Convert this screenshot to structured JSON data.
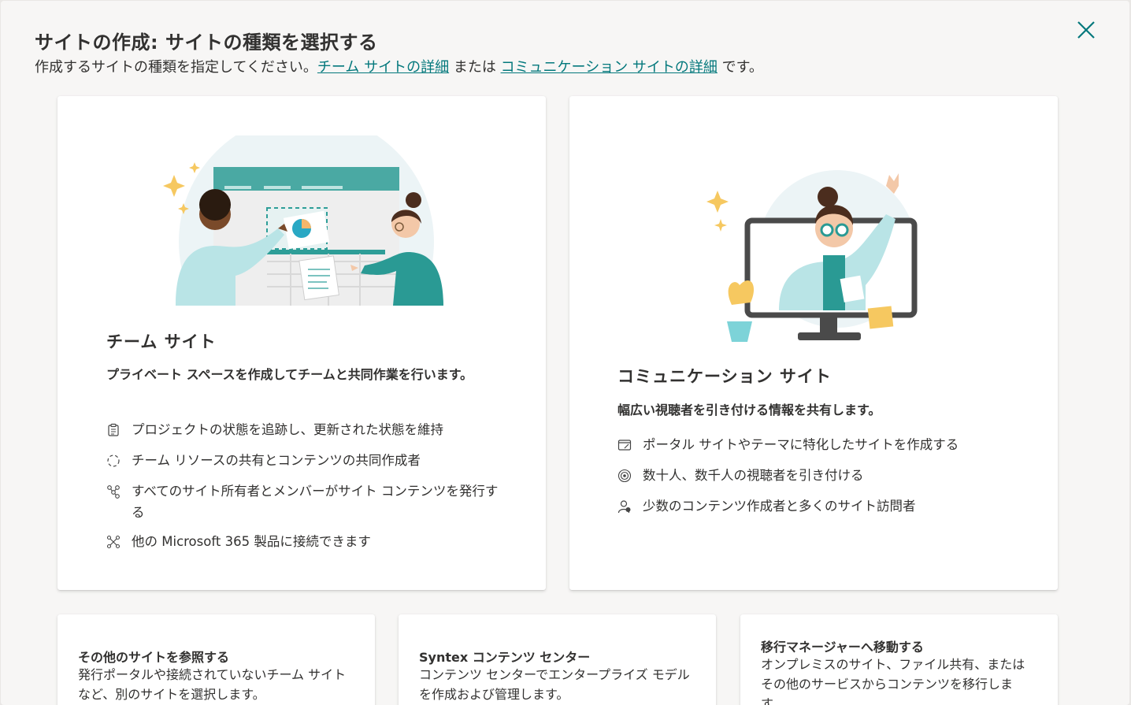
{
  "dialog": {
    "title": "サイトの作成: サイトの種類を選択する",
    "subtitle_prefix": "作成するサイトの種類を指定してください。",
    "link_team": "チーム サイトの詳細",
    "subtitle_mid": " または ",
    "link_comm": "コミュニケーション サイトの詳細",
    "subtitle_suffix": " です。",
    "accent_color": "#03787c"
  },
  "team_site": {
    "heading": "チーム サイト",
    "description": "プライベート スペースを作成してチームと共同作業を行います。",
    "features": [
      {
        "icon": "clipboard-icon",
        "text": "プロジェクトの状態を追跡し、更新された状態を維持"
      },
      {
        "icon": "sync-icon",
        "text": "チーム リソースの共有とコンテンツの共同作成者"
      },
      {
        "icon": "people-network-icon",
        "text": "すべてのサイト所有者とメンバーがサイト コンテンツを発行する"
      },
      {
        "icon": "connect-icon",
        "text": "他の Microsoft 365 製品に接続できます"
      }
    ]
  },
  "communication_site": {
    "heading": "コミュニケーション サイト",
    "description": "幅広い視聴者を引き付ける情報を共有します。",
    "features": [
      {
        "icon": "publish-icon",
        "text": "ポータル サイトやテーマに特化したサイトを作成する"
      },
      {
        "icon": "broadcast-icon",
        "text": "数十人、数千人の視聴者を引き付ける"
      },
      {
        "icon": "person-icon",
        "text": "少数のコンテンツ作成者と多くのサイト訪問者"
      }
    ]
  },
  "other_options": [
    {
      "title": "その他のサイトを参照する",
      "description": "発行ポータルや接続されていないチーム サイトなど、別のサイトを選択します。"
    },
    {
      "title": "Syntex コンテンツ センター",
      "description": "コンテンツ センターでエンタープライズ モデルを作成および管理します。"
    },
    {
      "title": "移行マネージャーへ移動する",
      "description": "オンプレミスのサイト、ファイル共有、またはその他のサービスからコンテンツを移行します。"
    }
  ]
}
